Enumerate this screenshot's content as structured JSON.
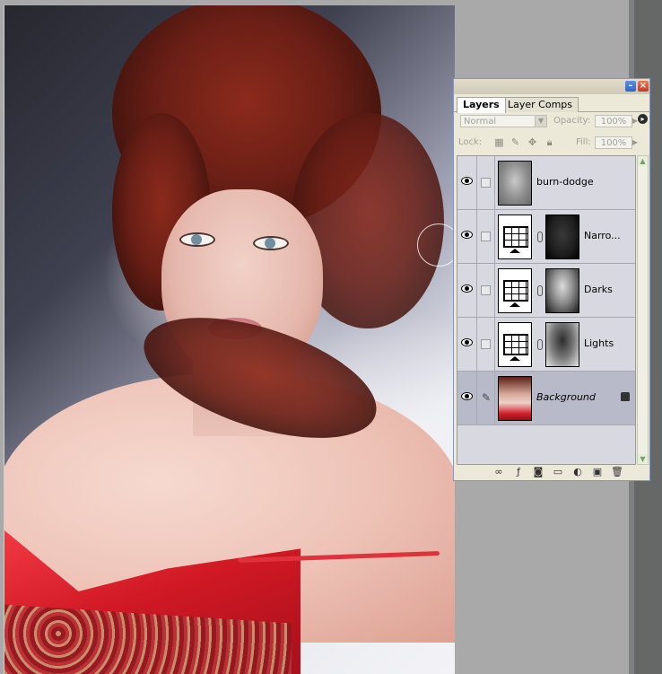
{
  "canvas": {
    "description_icon": "brush-cursor-icon"
  },
  "palette": {
    "tabs": [
      {
        "label": "Layers",
        "active": true
      },
      {
        "label": "Layer Comps",
        "active": false
      }
    ],
    "blend_mode": "Normal",
    "opacity_label": "Opacity:",
    "opacity_value": "100%",
    "lock_label": "Lock:",
    "fill_label": "Fill:",
    "fill_value": "100%",
    "layers": [
      {
        "name": "burn-dodge",
        "type": "pixel",
        "visible": true
      },
      {
        "name": "Narro...",
        "type": "curves-adjustment",
        "visible": true
      },
      {
        "name": "Darks",
        "type": "curves-adjustment",
        "visible": true
      },
      {
        "name": "Lights",
        "type": "curves-adjustment",
        "visible": true
      },
      {
        "name": "Background",
        "type": "background",
        "visible": true,
        "selected": true,
        "locked": true
      }
    ],
    "bottom_icons": [
      "link-layers-icon",
      "layer-style-icon",
      "add-mask-icon",
      "new-group-icon",
      "adjustment-layer-icon",
      "new-layer-icon",
      "trash-icon"
    ]
  },
  "colors": {
    "workspace": "#a9a9a9",
    "panel": "#ece9d8",
    "layer_list": "#d8d9e0",
    "selected_layer": "#b8bac9"
  }
}
